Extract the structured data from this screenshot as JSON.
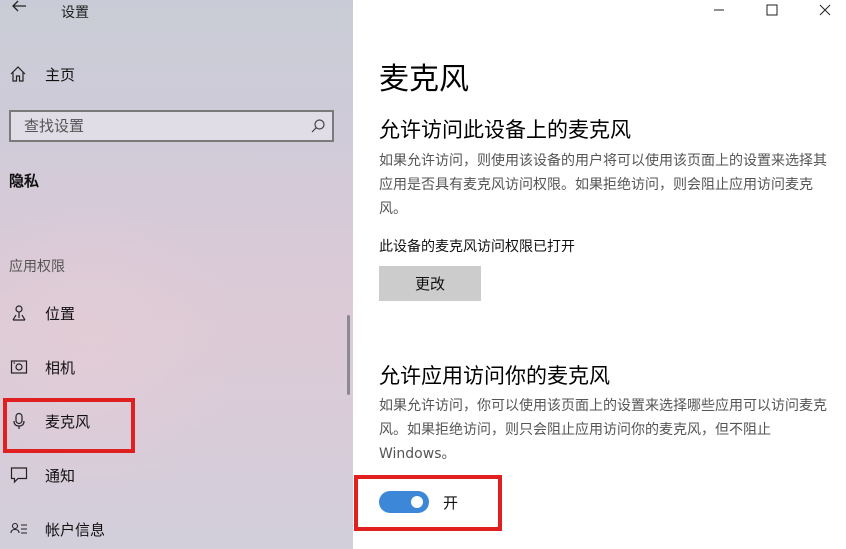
{
  "window": {
    "title": "设置"
  },
  "sidebar": {
    "home_label": "主页",
    "search_placeholder": "查找设置",
    "section_title": "隐私",
    "group_label": "应用权限",
    "items": [
      {
        "label": "位置",
        "icon": "location-icon"
      },
      {
        "label": "相机",
        "icon": "camera-icon"
      },
      {
        "label": "麦克风",
        "icon": "microphone-icon",
        "selected": true
      },
      {
        "label": "通知",
        "icon": "notification-icon"
      },
      {
        "label": "帐户信息",
        "icon": "account-info-icon"
      }
    ]
  },
  "main": {
    "title": "麦克风",
    "device_section": {
      "heading": "允许访问此设备上的麦克风",
      "description": "如果允许访问，则使用该设备的用户将可以使用该页面上的设置来选择其应用是否具有麦克风访问权限。如果拒绝访问，则会阻止应用访问麦克风。",
      "status": "此设备的麦克风访问权限已打开",
      "change_button": "更改"
    },
    "app_section": {
      "heading": "允许应用访问你的麦克风",
      "description": "如果允许访问，你可以使用该页面上的设置来选择哪些应用可以访问麦克风。如果拒绝访问，则只会阻止应用访问你的麦克风，但不阻止 Windows。",
      "toggle_state": "开",
      "toggle_on": true
    }
  },
  "colors": {
    "accent": "#3c87d8",
    "highlight": "#e02020",
    "button_bg": "#cccccc"
  }
}
